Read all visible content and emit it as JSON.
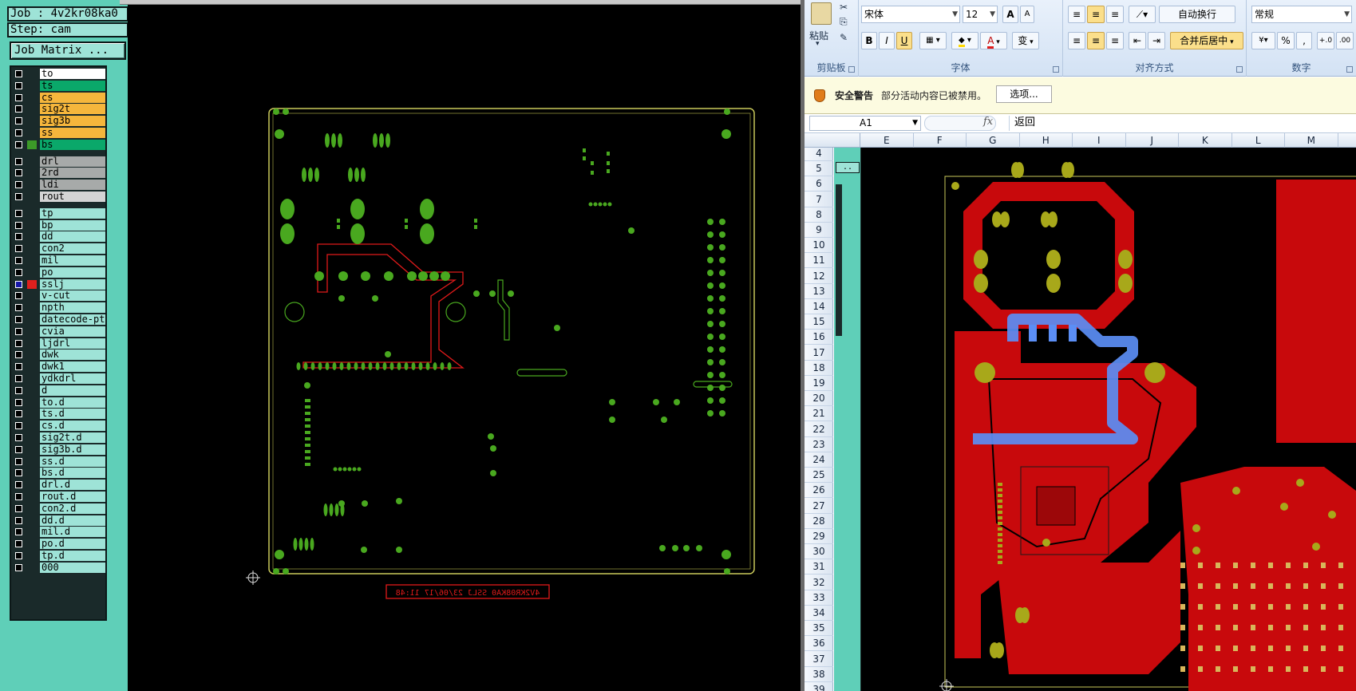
{
  "cam": {
    "job_label": "Job : 4v2kr08ka0",
    "step_label": "Step: cam",
    "matrix_button": "Job Matrix ...",
    "layers": [
      {
        "name": "to",
        "color": "#ffffff",
        "active": false,
        "mark": ""
      },
      {
        "name": "ts",
        "color": "#0aa86a",
        "active": false,
        "mark": ""
      },
      {
        "name": "cs",
        "color": "#f5b63c",
        "active": false,
        "mark": ""
      },
      {
        "name": "sig2t",
        "color": "#f5b63c",
        "active": false,
        "mark": ""
      },
      {
        "name": "sig3b",
        "color": "#f5b63c",
        "active": false,
        "mark": ""
      },
      {
        "name": "ss",
        "color": "#f5b63c",
        "active": false,
        "mark": ""
      },
      {
        "name": "bs",
        "color": "#0aa86a",
        "active": false,
        "mark": "#3c9a28"
      },
      {
        "name": "drl",
        "color": "#a7aaa9",
        "active": false,
        "mark": ""
      },
      {
        "name": "2rd",
        "color": "#a7aaa9",
        "active": false,
        "mark": ""
      },
      {
        "name": "ldi",
        "color": "#a7aaa9",
        "active": false,
        "mark": ""
      },
      {
        "name": "rout",
        "color": "#d4d4d4",
        "active": false,
        "mark": ""
      },
      {
        "name": "tp",
        "color": "#9ee3d7",
        "active": false,
        "mark": ""
      },
      {
        "name": "bp",
        "color": "#9ee3d7",
        "active": false,
        "mark": ""
      },
      {
        "name": "dd",
        "color": "#9ee3d7",
        "active": false,
        "mark": ""
      },
      {
        "name": "con2",
        "color": "#9ee3d7",
        "active": false,
        "mark": ""
      },
      {
        "name": "mil",
        "color": "#9ee3d7",
        "active": false,
        "mark": ""
      },
      {
        "name": "po",
        "color": "#9ee3d7",
        "active": false,
        "mark": ""
      },
      {
        "name": "sslj",
        "color": "#9ee3d7",
        "active": true,
        "mark": "#e0201e"
      },
      {
        "name": "v-cut",
        "color": "#9ee3d7",
        "active": false,
        "mark": ""
      },
      {
        "name": "npth",
        "color": "#9ee3d7",
        "active": false,
        "mark": ""
      },
      {
        "name": "datecode-ptc",
        "color": "#9ee3d7",
        "active": false,
        "mark": ""
      },
      {
        "name": "cvia",
        "color": "#9ee3d7",
        "active": false,
        "mark": ""
      },
      {
        "name": "ljdrl",
        "color": "#9ee3d7",
        "active": false,
        "mark": ""
      },
      {
        "name": "dwk",
        "color": "#9ee3d7",
        "active": false,
        "mark": ""
      },
      {
        "name": "dwk1",
        "color": "#9ee3d7",
        "active": false,
        "mark": ""
      },
      {
        "name": "ydkdrl",
        "color": "#9ee3d7",
        "active": false,
        "mark": ""
      },
      {
        "name": "d",
        "color": "#9ee3d7",
        "active": false,
        "mark": ""
      },
      {
        "name": "to.d",
        "color": "#9ee3d7",
        "active": false,
        "mark": ""
      },
      {
        "name": "ts.d",
        "color": "#9ee3d7",
        "active": false,
        "mark": ""
      },
      {
        "name": "cs.d",
        "color": "#9ee3d7",
        "active": false,
        "mark": ""
      },
      {
        "name": "sig2t.d",
        "color": "#9ee3d7",
        "active": false,
        "mark": ""
      },
      {
        "name": "sig3b.d",
        "color": "#9ee3d7",
        "active": false,
        "mark": ""
      },
      {
        "name": "ss.d",
        "color": "#9ee3d7",
        "active": false,
        "mark": ""
      },
      {
        "name": "bs.d",
        "color": "#9ee3d7",
        "active": false,
        "mark": ""
      },
      {
        "name": "drl.d",
        "color": "#9ee3d7",
        "active": false,
        "mark": ""
      },
      {
        "name": "rout.d",
        "color": "#9ee3d7",
        "active": false,
        "mark": ""
      },
      {
        "name": "con2.d",
        "color": "#9ee3d7",
        "active": false,
        "mark": ""
      },
      {
        "name": "dd.d",
        "color": "#9ee3d7",
        "active": false,
        "mark": ""
      },
      {
        "name": "mil.d",
        "color": "#9ee3d7",
        "active": false,
        "mark": ""
      },
      {
        "name": "po.d",
        "color": "#9ee3d7",
        "active": false,
        "mark": ""
      },
      {
        "name": "tp.d",
        "color": "#9ee3d7",
        "active": false,
        "mark": ""
      },
      {
        "name": "000",
        "color": "#9ee3d7",
        "active": false,
        "mark": ""
      }
    ],
    "canvas": {
      "background": "#000000",
      "pad_color": "#49a81f",
      "trace_color": "#e01a1a",
      "outline_color": "#c9c95a",
      "datecode_text": "4V2KR08KA0 SSLJ 23/06/17 11:48"
    }
  },
  "excel": {
    "ribbon": {
      "paste_label": "粘贴",
      "clipboard_group": "剪贴板",
      "font_name": "宋体",
      "font_size": "12",
      "grow_font": "A",
      "shrink_font": "A",
      "bold": "B",
      "italic": "I",
      "underline": "U",
      "font_color_glyph": "A",
      "phonetic_glyph": "变",
      "font_group": "字体",
      "wrap_text": "自动换行",
      "merge_center": "合并后居中",
      "alignment_group": "对齐方式",
      "number_format": "常规",
      "percent": "%",
      "comma": ",",
      "number_group": "数字"
    },
    "security": {
      "title": "安全警告",
      "message": "部分活动内容已被禁用。",
      "options_button": "选项..."
    },
    "formula_bar": {
      "cell_ref": "A1",
      "fx": "fx",
      "value": "返回"
    },
    "columns": [
      "E",
      "F",
      "G",
      "H",
      "I",
      "J",
      "K",
      "L",
      "M"
    ],
    "rows": [
      "4",
      "5",
      "6",
      "7",
      "8",
      "9",
      "10",
      "11",
      "12",
      "13",
      "14",
      "15",
      "16",
      "17",
      "18",
      "19",
      "20",
      "21",
      "22",
      "23",
      "24",
      "25",
      "26",
      "27",
      "28",
      "29",
      "30",
      "31",
      "32",
      "33",
      "34",
      "35",
      "36",
      "37",
      "38",
      "39"
    ],
    "embed_button": "..",
    "colors": {
      "copper": "#c8090c",
      "highlight_trace": "#5b8ef5",
      "pad_yellow": "#a8a81a"
    }
  }
}
